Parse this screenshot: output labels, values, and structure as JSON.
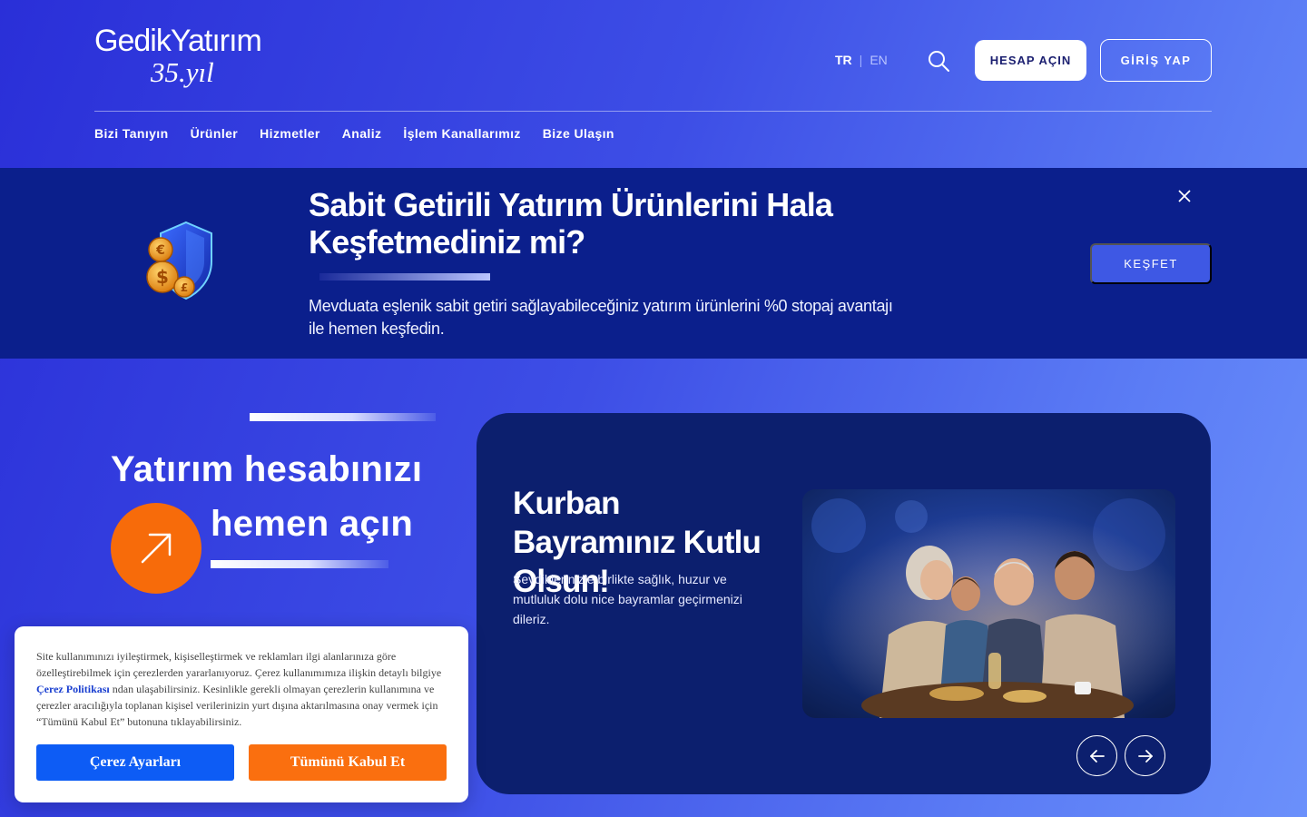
{
  "header": {
    "logo": {
      "brand": "GedikYatırım",
      "tagline": "35.yıl"
    },
    "languages": {
      "active": "TR",
      "separator": "|",
      "inactive": "EN"
    },
    "search_icon": "search-icon",
    "open_account_label": "HESAP AÇIN",
    "login_label": "GİRİŞ YAP",
    "nav": [
      {
        "label": "Bizi Tanıyın"
      },
      {
        "label": "Ürünler"
      },
      {
        "label": "Hizmetler"
      },
      {
        "label": "Analiz"
      },
      {
        "label": "İşlem Kanallarımız"
      },
      {
        "label": "Bize Ulaşın"
      }
    ]
  },
  "promo": {
    "title": "Sabit Getirili Yatırım Ürünlerini Hala Keşfetmediniz mi?",
    "description": "Mevduata eşlenik sabit getiri sağlayabileceğiniz yatırım ürünlerini %0 stopaj avantajı ile hemen keşfedin.",
    "cta_label": "KEŞFET",
    "icon": "coins-shield-icon",
    "close_icon": "close-icon"
  },
  "hero": {
    "line1": "Yatırım hesabınızı",
    "line2": "hemen açın",
    "arrow_icon": "arrow-up-right-icon"
  },
  "card": {
    "title": "Kurban Bayramınız Kutlu Olsun!",
    "description": "Sevdiklerinizle birlikte sağlık, huzur ve mutluluk dolu nice bayramlar geçirmenizi dileriz.",
    "prev_icon": "arrow-left-icon",
    "next_icon": "arrow-right-icon"
  },
  "cookie": {
    "text_before": "Site kullanımınızı iyileştirmek, kişiselleştirmek ve reklamları ilgi alanlarınıza göre özelleştirebilmek için çerezlerden yararlanıyoruz. Çerez kullanımımıza ilişkin detaylı bilgiye ",
    "link": "Çerez Politikası",
    "text_after": " ndan ulaşabilirsiniz. Kesinlikle gerekli olmayan çerezlerin kullanımına ve çerezler aracılığıyla toplanan kişisel verilerinizin yurt dışına aktarılmasına onay vermek için “Tümünü Kabul Et” butonuna tıklayabilirsiniz.",
    "settings_label": "Çerez Ayarları",
    "accept_label": "Tümünü Kabul Et"
  },
  "colors": {
    "accent_orange": "#f76b0a",
    "promo_bg": "#0b1f8c",
    "card_bg": "#0c1f6e",
    "cookie_blue": "#0d5cf5"
  }
}
